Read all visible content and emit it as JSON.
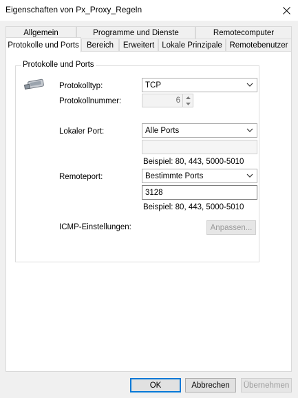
{
  "window": {
    "title": "Eigenschaften von Px_Proxy_Regeln"
  },
  "tabs": {
    "row1": [
      "Allgemein",
      "Programme und Dienste",
      "Remotecomputer"
    ],
    "row2": [
      "Protokolle und Ports",
      "Bereich",
      "Erweitert",
      "Lokale Prinzipale",
      "Remotebenutzer"
    ],
    "active": "Protokolle und Ports"
  },
  "group": {
    "title": "Protokolle und Ports",
    "protocol_type_label": "Protokolltyp:",
    "protocol_type_value": "TCP",
    "protocol_number_label": "Protokollnummer:",
    "protocol_number_value": "6",
    "local_port_label": "Lokaler Port:",
    "local_port_value": "Alle Ports",
    "local_port_input": "",
    "local_port_hint": "Beispiel: 80, 443, 5000-5010",
    "remote_port_label": "Remoteport:",
    "remote_port_value": "Bestimmte Ports",
    "remote_port_input": "3128",
    "remote_port_hint": "Beispiel: 80, 443, 5000-5010",
    "icmp_label": "ICMP-Einstellungen:",
    "icmp_button": "Anpassen..."
  },
  "buttons": {
    "ok": "OK",
    "cancel": "Abbrechen",
    "apply": "Übernehmen"
  },
  "colors": {
    "accent": "#0078d7",
    "panel": "#ffffff",
    "window": "#f0f0f0"
  }
}
